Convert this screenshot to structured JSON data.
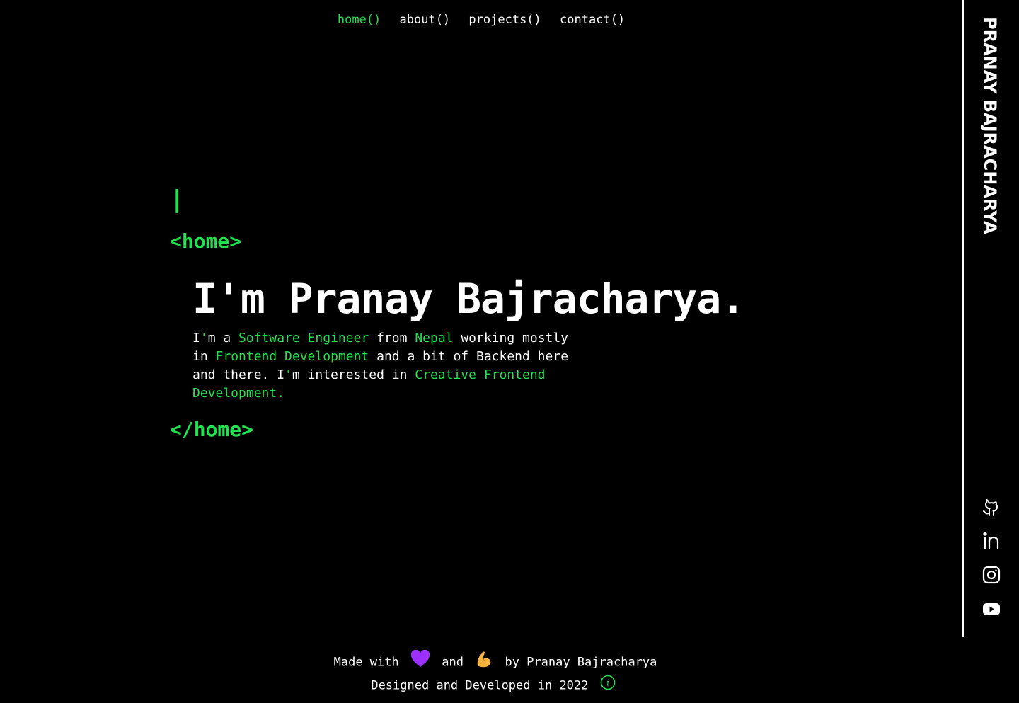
{
  "nav": {
    "items": [
      {
        "label": "home()",
        "active": true
      },
      {
        "label": "about()",
        "active": false
      },
      {
        "label": "projects()",
        "active": false
      },
      {
        "label": "contact()",
        "active": false
      }
    ]
  },
  "sidebar": {
    "name": "PRANAY BAJRACHARYA",
    "socials": [
      {
        "icon": "github-icon"
      },
      {
        "icon": "linkedin-icon"
      },
      {
        "icon": "instagram-icon"
      },
      {
        "icon": "youtube-icon"
      }
    ]
  },
  "main": {
    "cursor": "|",
    "open_tag": "<home>",
    "close_tag": "</home>",
    "headline": "I'm Pranay Bajracharya.",
    "intro": {
      "p1": "I",
      "apos1": "'",
      "p2": "m a ",
      "role": "Software Engineer",
      "p3": " from ",
      "country": "Nepal",
      "p4": " working mostly in ",
      "focus": "Frontend Development",
      "p5": " and a bit of Backend here and there. I",
      "apos2": "'",
      "p6": "m interested in ",
      "interest": "Creative Frontend Development."
    }
  },
  "footer": {
    "made_with": "Made with",
    "and": "and",
    "by": "by Pranay Bajracharya",
    "designed": "Designed and Developed in 2022",
    "info": "i"
  },
  "colors": {
    "accent": "#22e04f",
    "background": "#000000",
    "heart": "#9b30ff",
    "arm": "#f5b342"
  }
}
